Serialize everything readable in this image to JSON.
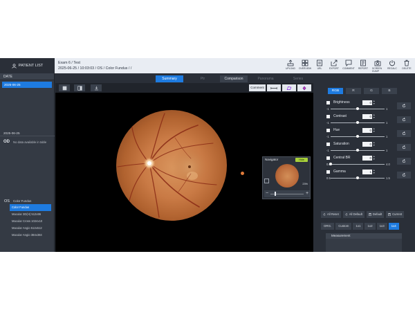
{
  "header": {
    "patient_list_label": "PATIENT LIST",
    "exam_title": "Exam 6 / Test",
    "exam_details": "2025-06-25 / 10:03:03 / OS / Color Fundus / /",
    "toolbar": [
      {
        "name": "upload",
        "label": "UPLOAD",
        "icon": "upload-icon"
      },
      {
        "name": "overview",
        "label": "OVERVIEW",
        "icon": "grid-icon"
      },
      {
        "name": "url",
        "label": "URL",
        "icon": "link-icon"
      },
      {
        "name": "export",
        "label": "EXPORT",
        "icon": "export-icon"
      },
      {
        "name": "comment",
        "label": "COMMENT",
        "icon": "comment-icon"
      },
      {
        "name": "report",
        "label": "REPORT",
        "icon": "report-icon"
      },
      {
        "name": "screen-dump",
        "label": "SCREEN DUMP",
        "icon": "camera-icon"
      },
      {
        "name": "recalc",
        "label": "RECALC",
        "icon": "power-icon"
      },
      {
        "name": "delete",
        "label": "DELETE",
        "icon": "trash-icon"
      }
    ]
  },
  "left_panel": {
    "date_header": "DATE",
    "selected_date": "2025-06-25",
    "second_date": "2025-06-25",
    "od_label": "OD",
    "od_no_data": "No data available in table",
    "os_label": "OS",
    "os_type": "Color Fundus",
    "series": [
      "Color Fundus",
      "Macular 3D(H) 512x96",
      "Macular Cross 1024x10",
      "Macular Angio 512x512",
      "Macular Angio 384x384"
    ]
  },
  "tabs": [
    "Summary",
    "Ptr",
    "Comparison",
    "Panorama",
    "Series"
  ],
  "viewer": {
    "comment_label": "Comment",
    "navigator_title": "Navigator",
    "hide_label": "Hide",
    "zoom_text": "23%",
    "slider_level": 0.12
  },
  "right_panel": {
    "channels": [
      "RGB",
      "R",
      "G",
      "B"
    ],
    "adjustments": [
      {
        "label": "Brightness",
        "value": "0",
        "min": "-1",
        "max": "1",
        "position": 0.5
      },
      {
        "label": "Contrast",
        "value": "0",
        "min": "-1",
        "max": "1",
        "position": 0.5
      },
      {
        "label": "Hue",
        "value": "0",
        "min": "-1",
        "max": "1",
        "position": 0.5
      },
      {
        "label": "Saturation",
        "value": "0",
        "min": "-1",
        "max": "1",
        "position": 0.5
      },
      {
        "label": "Central BR",
        "value": "0",
        "min": "0.0",
        "max": "4.0",
        "position": 0.0
      },
      {
        "label": "Gamma",
        "value": "1",
        "min": "0.5",
        "max": "1.5",
        "position": 0.5
      }
    ],
    "presets": [
      "All Reset",
      "All Default",
      "Default",
      "Current"
    ],
    "view_buttons": [
      "ORG.",
      "Custom",
      "1x1",
      "1x2",
      "1x3",
      "1x4"
    ],
    "active_view": "1x4",
    "measurement_title": "Measurement"
  },
  "colors": {
    "accent": "#1e7be0",
    "panel": "#2a2f38",
    "header_bg": "#e9edf3",
    "hide_badge": "#a8d13a"
  }
}
